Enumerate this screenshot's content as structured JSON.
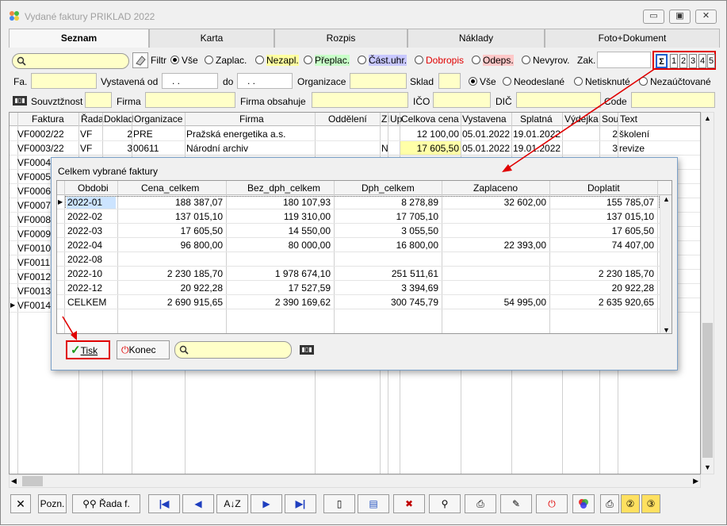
{
  "window": {
    "title": "Vydané faktury PRIKLAD  2022",
    "controls": [
      "minimize",
      "maximize",
      "close"
    ]
  },
  "tabs": [
    {
      "label": "Seznam",
      "active": true
    },
    {
      "label": "Karta",
      "active": false
    },
    {
      "label": "Rozpis",
      "active": false
    },
    {
      "label": "Náklady",
      "active": false
    },
    {
      "label": "Foto+Dokument",
      "active": false
    }
  ],
  "filters": {
    "search_value": "",
    "filtr_label": "Filtr",
    "status_options": [
      {
        "label": "Vše",
        "selected": true,
        "bg": ""
      },
      {
        "label": "Zaplac.",
        "selected": false,
        "bg": ""
      },
      {
        "label": "Nezapl.",
        "selected": false,
        "bg": "#ffffa0"
      },
      {
        "label": "Přeplac.",
        "selected": false,
        "bg": "#c8ffc8"
      },
      {
        "label": "Část.uhr.",
        "selected": false,
        "bg": "#c8c8ff"
      },
      {
        "label": "Dobropis",
        "selected": false,
        "bg": "",
        "color": "#e00000"
      },
      {
        "label": "Odeps.",
        "selected": false,
        "bg": "#ffc8c8"
      },
      {
        "label": "Nevyrov.",
        "selected": false,
        "bg": ""
      }
    ],
    "zak_label": "Zak.",
    "sum_buttons": [
      "Σ",
      "1",
      "2",
      "3",
      "4",
      "5"
    ],
    "fa_label": "Fa.",
    "vystavena_od_label": "Vystavená od",
    "date_from": " .  .",
    "do_label": "do",
    "date_to": " .  .",
    "organizace_label": "Organizace",
    "sklad_label": "Sklad",
    "send_options": [
      {
        "label": "Vše",
        "selected": true
      },
      {
        "label": "Neodeslané",
        "selected": false
      },
      {
        "label": "Netisknuté",
        "selected": false
      },
      {
        "label": "Nezaúčtované",
        "selected": false
      }
    ],
    "souvztaznost_label": "Souvztžnost",
    "firma_label": "Firma",
    "firma_obsahuje_label": "Firma obsahuje",
    "ico_label": "IČO",
    "dic_label": "DIČ",
    "code_label": "Code"
  },
  "grid": {
    "columns": [
      "Faktura",
      "Řada",
      "Doklad",
      "Organizace",
      "Firma",
      "Oddělení",
      "Zl",
      "Up",
      "Celkova cena",
      "Vystavena",
      "Splatná",
      "Výdejka",
      "Sou",
      "Text"
    ],
    "rows": [
      {
        "faktura": "VF0002/22",
        "rada": "VF",
        "doklad": "2",
        "org": "PRE",
        "firma": "Pražská energetika a.s.",
        "zl": "",
        "cena": "12 100,00",
        "vystavena": "05.01.2022",
        "splatna": "19.01.2022",
        "sou": "2",
        "text": "školení",
        "highlight": false
      },
      {
        "faktura": "VF0003/22",
        "rada": "VF",
        "doklad": "3",
        "org": "00611",
        "firma": "Národní archiv",
        "zl": "N",
        "cena": "17 605,50",
        "vystavena": "05.01.2022",
        "splatna": "19.01.2022",
        "sou": "3",
        "text": "revize",
        "highlight": true
      },
      {
        "faktura": "VF0004",
        "rada": "",
        "doklad": "",
        "org": "",
        "firma": "",
        "zl": "",
        "cena": "",
        "vystavena": "",
        "splatna": "",
        "sou": "",
        "text": "",
        "highlight": false
      },
      {
        "faktura": "VF0005",
        "rada": "",
        "doklad": "",
        "org": "",
        "firma": "",
        "zl": "",
        "cena": "",
        "vystavena": "",
        "splatna": "",
        "sou": "",
        "text": "",
        "highlight": false
      },
      {
        "faktura": "VF0006",
        "rada": "",
        "doklad": "",
        "org": "",
        "firma": "",
        "zl": "",
        "cena": "",
        "vystavena": "",
        "splatna": "",
        "sou": "",
        "text": "",
        "highlight": false
      },
      {
        "faktura": "VF0007",
        "rada": "",
        "doklad": "",
        "org": "",
        "firma": "",
        "zl": "",
        "cena": "",
        "vystavena": "",
        "splatna": "",
        "sou": "",
        "text": "",
        "highlight": false
      },
      {
        "faktura": "VF0008",
        "rada": "",
        "doklad": "",
        "org": "",
        "firma": "",
        "zl": "",
        "cena": "",
        "vystavena": "",
        "splatna": "",
        "sou": "",
        "text": "e",
        "highlight": false
      },
      {
        "faktura": "VF0009",
        "rada": "",
        "doklad": "",
        "org": "",
        "firma": "",
        "zl": "",
        "cena": "",
        "vystavena": "",
        "splatna": "",
        "sou": "",
        "text": "",
        "highlight": false
      },
      {
        "faktura": "VF0010",
        "rada": "",
        "doklad": "",
        "org": "",
        "firma": "",
        "zl": "",
        "cena": "",
        "vystavena": "",
        "splatna": "",
        "sou": "",
        "text": "",
        "highlight": false
      },
      {
        "faktura": "VF0011",
        "rada": "",
        "doklad": "",
        "org": "",
        "firma": "",
        "zl": "",
        "cena": "",
        "vystavena": "",
        "splatna": "",
        "sou": "",
        "text": "",
        "highlight": false
      },
      {
        "faktura": "VF0012",
        "rada": "",
        "doklad": "",
        "org": "",
        "firma": "",
        "zl": "",
        "cena": "",
        "vystavena": "",
        "splatna": "",
        "sou": "",
        "text": "",
        "highlight": false
      },
      {
        "faktura": "VF0013",
        "rada": "",
        "doklad": "",
        "org": "",
        "firma": "",
        "zl": "",
        "cena": "",
        "vystavena": "",
        "splatna": "",
        "sou": "",
        "text": "",
        "highlight": false
      },
      {
        "faktura": "VF0014",
        "rada": "",
        "doklad": "",
        "org": "",
        "firma": "",
        "zl": "",
        "cena": "",
        "vystavena": "",
        "splatna": "",
        "sou": "",
        "text": "",
        "highlight": false
      }
    ]
  },
  "dialog": {
    "title": "Celkem vybrané faktury",
    "columns": [
      "Obdobi",
      "Cena_celkem",
      "Bez_dph_celkem",
      "Dph_celkem",
      "Zaplaceno",
      "Doplatit"
    ],
    "rows": [
      [
        "2022-01",
        "188 387,07",
        "180 107,93",
        "8 278,89",
        "32 602,00",
        "155 785,07"
      ],
      [
        "2022-02",
        "137 015,10",
        "119 310,00",
        "17 705,10",
        "",
        "137 015,10"
      ],
      [
        "2022-03",
        "17 605,50",
        "14 550,00",
        "3 055,50",
        "",
        "17 605,50"
      ],
      [
        "2022-04",
        "96 800,00",
        "80 000,00",
        "16 800,00",
        "22 393,00",
        "74 407,00"
      ],
      [
        "2022-08",
        "",
        "",
        "",
        "",
        ""
      ],
      [
        "2022-10",
        "2 230 185,70",
        "1 978 674,10",
        "251 511,61",
        "",
        "2 230 185,70"
      ],
      [
        "2022-12",
        "20 922,28",
        "17 527,59",
        "3 394,69",
        "",
        "20 922,28"
      ],
      [
        "CELKEM",
        "2 690 915,65",
        "2 390 169,62",
        "300 745,79",
        "54 995,00",
        "2 635 920,65"
      ]
    ],
    "tisk_label": "Tisk",
    "konec_label": "Konec",
    "search_value": ""
  },
  "toolbar": {
    "pozn_label": "Pozn.",
    "rada_label": "Řada f.",
    "icons": [
      "close-icon",
      "binoculars-icon",
      "first-icon",
      "prev-icon",
      "sort-icon",
      "next-icon",
      "last-icon",
      "new-doc-icon",
      "edit-icon",
      "delete-icon",
      "find-icon",
      "print-icon",
      "pen-icon",
      "power-icon",
      "color-icon",
      "print-1-icon",
      "print-2-icon",
      "print-3-icon"
    ]
  },
  "colors": {
    "input_yellow": "#ffffc8",
    "highlight_red": "#e00000",
    "selection_blue": "#cce4ff"
  }
}
